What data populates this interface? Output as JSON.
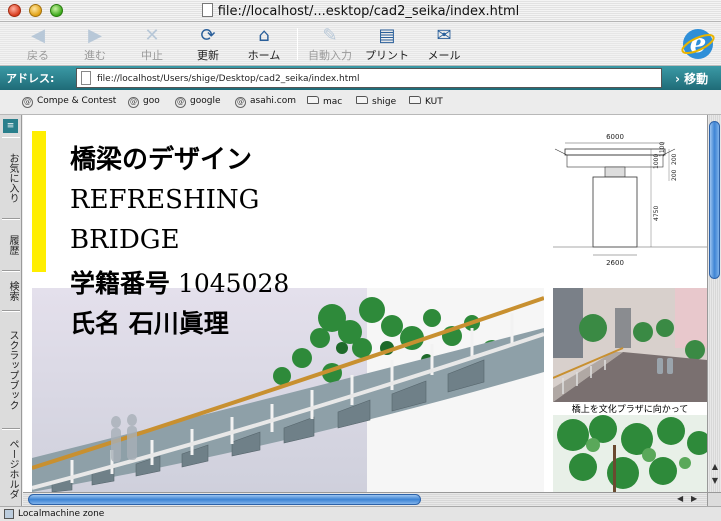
{
  "window": {
    "title": "file://localhost/...esktop/cad2_seika/index.html"
  },
  "toolbar": {
    "back": "戻る",
    "forward": "進む",
    "stop": "中止",
    "refresh": "更新",
    "home": "ホーム",
    "autofill": "自動入力",
    "print": "プリント",
    "mail": "メール"
  },
  "address": {
    "label": "アドレス:",
    "value": "file://localhost/Users/shige/Desktop/cad2_seika/index.html",
    "go": "移動"
  },
  "favorites": [
    {
      "label": "Compe & Contest",
      "icon": "at-icon"
    },
    {
      "label": "goo",
      "icon": "at-icon"
    },
    {
      "label": "google",
      "icon": "at-icon"
    },
    {
      "label": "asahi.com",
      "icon": "at-icon"
    },
    {
      "label": "mac",
      "icon": "folder-icon"
    },
    {
      "label": "shige",
      "icon": "folder-icon"
    },
    {
      "label": "KUT",
      "icon": "folder-icon"
    }
  ],
  "sidebar": {
    "tabs": [
      "お気に入り",
      "履歴",
      "検索",
      "スクラップブック",
      "ページホルダ"
    ]
  },
  "page": {
    "heading1": "橋梁のデザイン",
    "heading2": "REFRESHING",
    "heading3": "BRIDGE",
    "student_label": "学籍番号",
    "student_no": "1045028",
    "name_label": "氏名",
    "name": "石川眞理",
    "caption": "橋上を文化プラザに向かって",
    "drawing": {
      "width_top": "6000",
      "dim_right_1": "1000",
      "dim_right_2": "1100",
      "dim_right_3": "200",
      "dim_right_4": "200",
      "pier_height": "4750",
      "pier_width": "2600"
    }
  },
  "status": {
    "text": "Localmachine zone"
  },
  "colors": {
    "accent_bar": "#ffee00",
    "address_bar": "#2a7f8c",
    "scroll_thumb": "#3d84d4"
  }
}
